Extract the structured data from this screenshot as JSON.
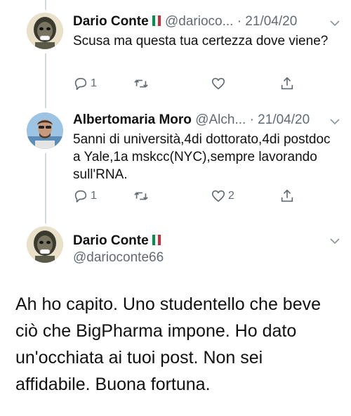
{
  "tweets": [
    {
      "name": "Dario Conte",
      "handle": "@darioco...",
      "date": "· 21/04/20",
      "text": "Scusa ma questa tua certezza dove viene?",
      "reply_count": "1",
      "retweet_count": "",
      "like_count": ""
    },
    {
      "name": "Albertomaria Moro",
      "handle": "@Alch...",
      "date": "· 21/04/20",
      "text": "5anni di università,4di dottorato,4di postdoc a Yale,1a mskcc(NYC),sempre lavorando sull'RNA.",
      "reply_count": "1",
      "retweet_count": "",
      "like_count": "2"
    }
  ],
  "focused_tweet": {
    "name": "Dario Conte",
    "handle": "@darioconte66",
    "text": "Ah ho capito. Uno studentello che beve ciò che BigPharma impone. Ho dato un'occhiata ai tuoi post. Non sei affidabile. Buona fortuna."
  },
  "colors": {
    "flag_green": "#009246",
    "flag_white": "#ffffff",
    "flag_red": "#ce2b37",
    "meta_gray": "#606b74",
    "thread_line": "#cfd9de"
  },
  "icons": [
    "reply-icon",
    "retweet-icon",
    "like-icon",
    "share-icon",
    "chevron-down-icon",
    "italy-flag-icon"
  ]
}
